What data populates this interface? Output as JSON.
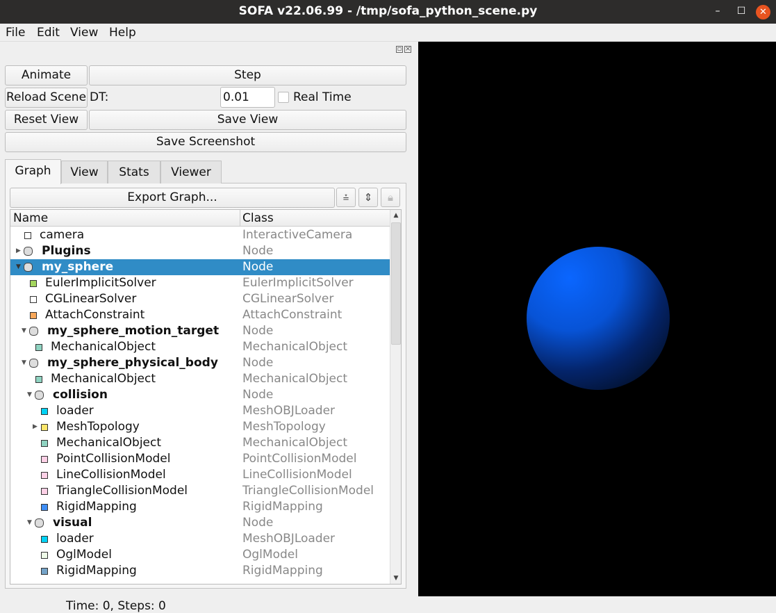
{
  "window": {
    "title": "SOFA v22.06.99 - /tmp/sofa_python_scene.py",
    "minimize": "–",
    "maximize": "☐",
    "close": "✕"
  },
  "menu": [
    "File",
    "Edit",
    "View",
    "Help"
  ],
  "controls": {
    "animate": "Animate",
    "step": "Step",
    "reload": "Reload Scene",
    "dt_label": "DT:",
    "dt_value": "0.01",
    "realtime_label": "Real Time",
    "realtime_checked": false,
    "reset_view": "Reset View",
    "save_view": "Save View",
    "save_screenshot": "Save Screenshot"
  },
  "tabs": [
    {
      "label": "Graph",
      "active": true
    },
    {
      "label": "View"
    },
    {
      "label": "Stats"
    },
    {
      "label": "Viewer"
    }
  ],
  "graph": {
    "export": "Export Graph...",
    "columns": [
      "Name",
      "Class"
    ],
    "rows": [
      {
        "name": "camera",
        "class": "InteractiveCamera",
        "level": 0,
        "icon": "#ffffff"
      },
      {
        "name": "Plugins",
        "class": "Node",
        "level": 0,
        "node": true,
        "arrow": "collapsed"
      },
      {
        "name": "my_sphere",
        "class": "Node",
        "level": 0,
        "node": true,
        "arrow": "expanded",
        "selected": true
      },
      {
        "name": "EulerImplicitSolver",
        "class": "EulerImplicitSolver",
        "level": 1,
        "icon": "#a4d65e"
      },
      {
        "name": "CGLinearSolver",
        "class": "CGLinearSolver",
        "level": 1,
        "icon": "#ffffff"
      },
      {
        "name": "AttachConstraint",
        "class": "AttachConstraint",
        "level": 1,
        "icon": "#f9a85a"
      },
      {
        "name": "my_sphere_motion_target",
        "class": "Node",
        "level": 1,
        "node": true,
        "arrow": "expanded"
      },
      {
        "name": "MechanicalObject",
        "class": "MechanicalObject",
        "level": 2,
        "icon": "#8fd3c1"
      },
      {
        "name": "my_sphere_physical_body",
        "class": "Node",
        "level": 1,
        "node": true,
        "arrow": "expanded"
      },
      {
        "name": "MechanicalObject",
        "class": "MechanicalObject",
        "level": 2,
        "icon": "#8fd3c1"
      },
      {
        "name": "collision",
        "class": "Node",
        "level": 2,
        "node": true,
        "arrow": "expanded"
      },
      {
        "name": "loader",
        "class": "MeshOBJLoader",
        "level": 3,
        "icon": "#00d2f5"
      },
      {
        "name": "MeshTopology",
        "class": "MeshTopology",
        "level": 3,
        "icon": "#fbe66a",
        "arrow": "collapsed"
      },
      {
        "name": "MechanicalObject",
        "class": "MechanicalObject",
        "level": 3,
        "icon": "#8fd3c1"
      },
      {
        "name": "PointCollisionModel",
        "class": "PointCollisionModel",
        "level": 3,
        "icon": "#fdd0e6"
      },
      {
        "name": "LineCollisionModel",
        "class": "LineCollisionModel",
        "level": 3,
        "icon": "#fdd0e6"
      },
      {
        "name": "TriangleCollisionModel",
        "class": "TriangleCollisionModel",
        "level": 3,
        "icon": "#fdd0e6"
      },
      {
        "name": "RigidMapping",
        "class": "RigidMapping",
        "level": 3,
        "icon": "#3f8ef5"
      },
      {
        "name": "visual",
        "class": "Node",
        "level": 2,
        "node": true,
        "arrow": "expanded"
      },
      {
        "name": "loader",
        "class": "MeshOBJLoader",
        "level": 3,
        "icon": "#00d2f5"
      },
      {
        "name": "OglModel",
        "class": "OglModel",
        "level": 3,
        "icon": "#eefbe8"
      },
      {
        "name": "RigidMapping",
        "class": "RigidMapping",
        "level": 3,
        "icon": "#74a3c8"
      }
    ]
  },
  "status": "Time: 0,   Steps:  0",
  "viewport": {
    "background": "#000000",
    "object_color": "#0a66ff"
  }
}
